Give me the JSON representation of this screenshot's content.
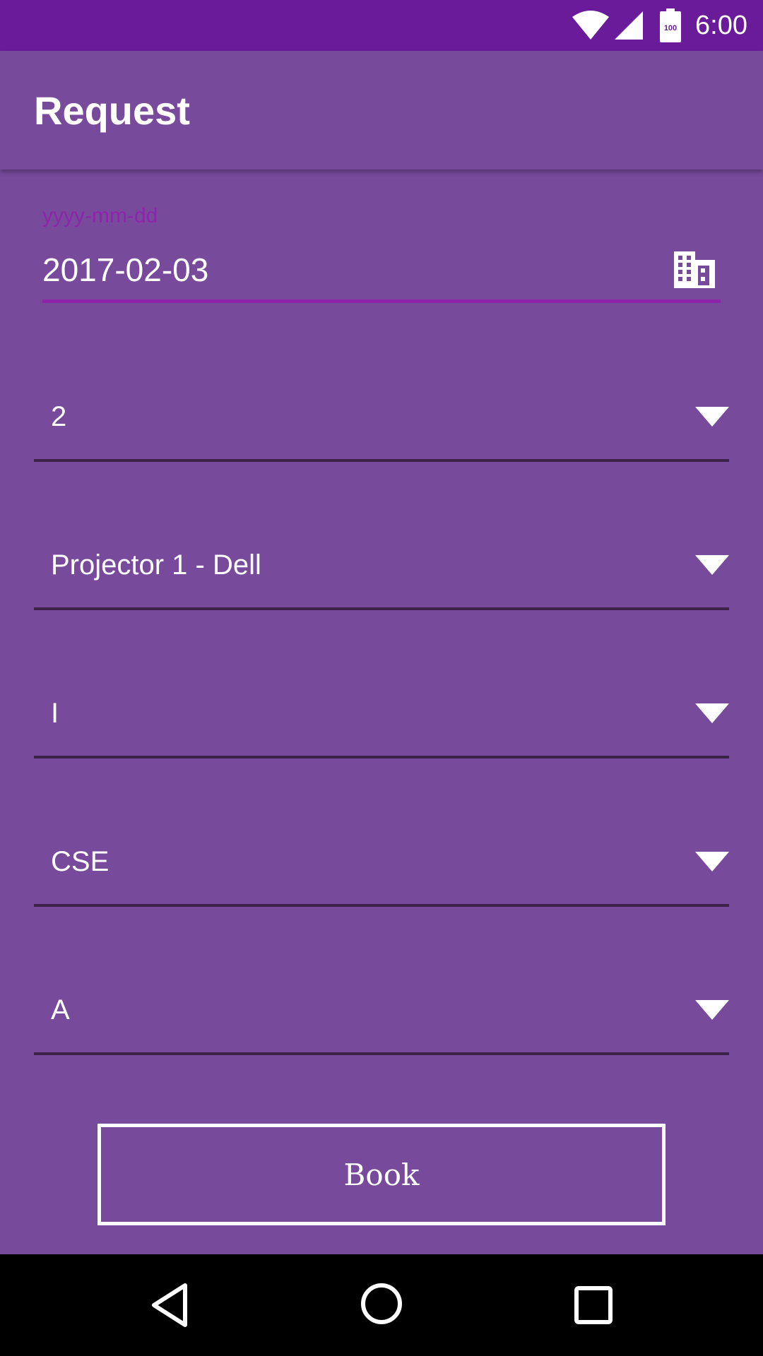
{
  "status_bar": {
    "time": "6:00",
    "battery_level": "100",
    "icons": [
      "wifi-icon",
      "cell-signal-icon",
      "battery-icon"
    ]
  },
  "app_bar": {
    "title": "Request"
  },
  "date_field": {
    "hint": "yyyy-mm-dd",
    "value": "2017-02-03",
    "icon": "calendar-icon"
  },
  "spinners": [
    {
      "value": "2"
    },
    {
      "value": "Projector 1 - Dell"
    },
    {
      "value": "I"
    },
    {
      "value": "CSE"
    },
    {
      "value": "A"
    }
  ],
  "book_button": {
    "label": "Book"
  },
  "nav_bar": {
    "icons": [
      "back-icon",
      "home-icon",
      "recents-icon"
    ]
  },
  "colors": {
    "status_bar": "#6a1b9a",
    "background": "#784a9c",
    "accent": "#8e24aa",
    "underline": "#3a2347",
    "nav_bar": "#000000",
    "text": "#ffffff"
  }
}
